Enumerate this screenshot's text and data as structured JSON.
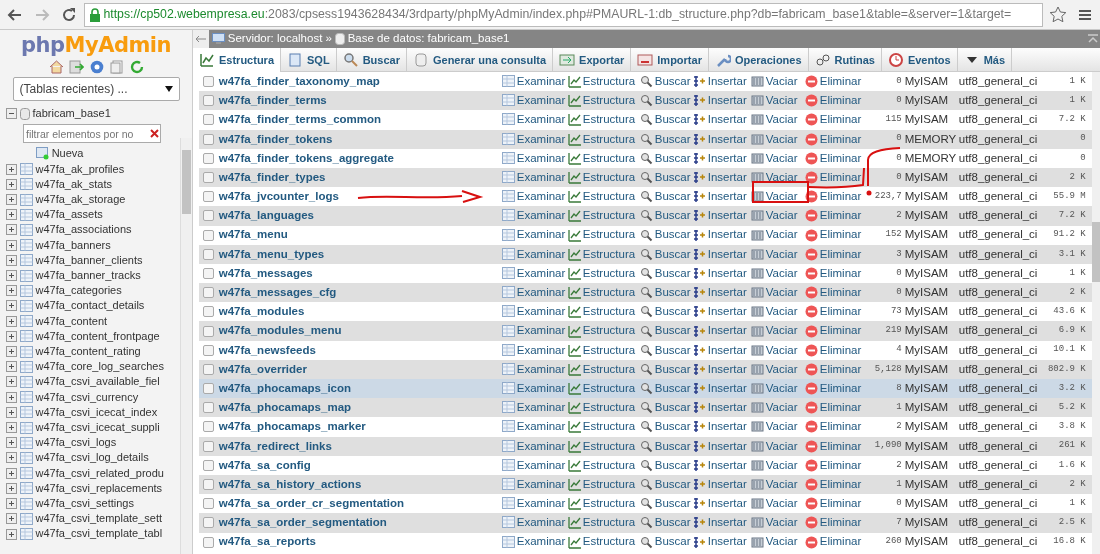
{
  "browser": {
    "url_host": "https://cp502.webempresa.eu",
    "url_rest": ":2083/cpsess1943628434/3rdparty/phpMyAdmin/index.php#PMAURL-1:db_structure.php?db=fabricam_base1&table=&server=1&target=",
    "forward_disabled": true
  },
  "sidebar": {
    "logo": [
      "php",
      "MyAdmin"
    ],
    "recent_select": "(Tablas recientes) ...",
    "tree": {
      "label": "fabricam_base1",
      "expanded": true,
      "filter_placeholder": "filtrar elementos por no",
      "new_label": "Nueva",
      "children": [
        {
          "label": "w47fa_ak_profiles",
          "expanded": false
        },
        {
          "label": "w47fa_ak_stats",
          "expanded": false
        },
        {
          "label": "w47fa_ak_storage",
          "expanded": false
        },
        {
          "label": "w47fa_assets",
          "expanded": false
        },
        {
          "label": "w47fa_associations",
          "expanded": false
        },
        {
          "label": "w47fa_banners",
          "expanded": false
        },
        {
          "label": "w47fa_banner_clients",
          "expanded": false
        },
        {
          "label": "w47fa_banner_tracks",
          "expanded": false
        },
        {
          "label": "w47fa_categories",
          "expanded": false
        },
        {
          "label": "w47fa_contact_details",
          "expanded": false
        },
        {
          "label": "w47fa_content",
          "expanded": false
        },
        {
          "label": "w47fa_content_frontpage",
          "expanded": false
        },
        {
          "label": "w47fa_content_rating",
          "expanded": false
        },
        {
          "label": "w47fa_core_log_searches",
          "expanded": false
        },
        {
          "label": "w47fa_csvi_available_fiel",
          "expanded": false
        },
        {
          "label": "w47fa_csvi_currency",
          "expanded": false
        },
        {
          "label": "w47fa_csvi_icecat_index",
          "expanded": false
        },
        {
          "label": "w47fa_csvi_icecat_suppli",
          "expanded": false
        },
        {
          "label": "w47fa_csvi_logs",
          "expanded": false
        },
        {
          "label": "w47fa_csvi_log_details",
          "expanded": false
        },
        {
          "label": "w47fa_csvi_related_produ",
          "expanded": false
        },
        {
          "label": "w47fa_csvi_replacements",
          "expanded": false
        },
        {
          "label": "w47fa_csvi_settings",
          "expanded": false
        },
        {
          "label": "w47fa_csvi_template_sett",
          "expanded": false
        },
        {
          "label": "w47fa_csvi_template_tabl",
          "expanded": false
        }
      ]
    }
  },
  "breadcrumb": {
    "server": "Servidor: localhost »",
    "database": "Base de datos: fabricam_base1"
  },
  "tabs": [
    {
      "label": "Estructura",
      "kind": "structure",
      "selected": true
    },
    {
      "label": "SQL",
      "kind": "sql",
      "selected": false
    },
    {
      "label": "Buscar",
      "kind": "search",
      "selected": false
    },
    {
      "label": "Generar una consulta",
      "kind": "query",
      "selected": false
    },
    {
      "label": "Exportar",
      "kind": "export",
      "selected": false
    },
    {
      "label": "Importar",
      "kind": "import",
      "selected": false
    },
    {
      "label": "Operaciones",
      "kind": "operations",
      "selected": false
    },
    {
      "label": "Rutinas",
      "kind": "routines",
      "selected": false
    },
    {
      "label": "Eventos",
      "kind": "events",
      "selected": false
    },
    {
      "label": "Más",
      "kind": "more",
      "selected": false
    }
  ],
  "table": {
    "rows": [
      {
        "name": "w47fa_finder_taxonomy_map",
        "checked": false,
        "selected": false,
        "actions": [
          "Examinar",
          "Estructura",
          "Buscar",
          "Insertar",
          "Vaciar",
          "Eliminar"
        ],
        "rows": "0",
        "engine": "MyISAM",
        "collation": "utf8_general_ci",
        "size": "1 K"
      },
      {
        "name": "w47fa_finder_terms",
        "checked": false,
        "selected": false,
        "actions": [
          "Examinar",
          "Estructura",
          "Buscar",
          "Insertar",
          "Vaciar",
          "Eliminar"
        ],
        "rows": "0",
        "engine": "MyISAM",
        "collation": "utf8_general_ci",
        "size": "1 K"
      },
      {
        "name": "w47fa_finder_terms_common",
        "checked": false,
        "selected": false,
        "actions": [
          "Examinar",
          "Estructura",
          "Buscar",
          "Insertar",
          "Vaciar",
          "Eliminar"
        ],
        "rows": "115",
        "engine": "MyISAM",
        "collation": "utf8_general_ci",
        "size": "7.2 K"
      },
      {
        "name": "w47fa_finder_tokens",
        "checked": false,
        "selected": false,
        "actions": [
          "Examinar",
          "Estructura",
          "Buscar",
          "Insertar",
          "Vaciar",
          "Eliminar"
        ],
        "rows": "0",
        "engine": "MEMORY",
        "collation": "utf8_general_ci",
        "size": "0"
      },
      {
        "name": "w47fa_finder_tokens_aggregate",
        "checked": false,
        "selected": false,
        "actions": [
          "Examinar",
          "Estructura",
          "Buscar",
          "Insertar",
          "Vaciar",
          "Eliminar"
        ],
        "rows": "0",
        "engine": "MEMORY",
        "collation": "utf8_general_ci",
        "size": "0"
      },
      {
        "name": "w47fa_finder_types",
        "checked": false,
        "selected": false,
        "actions": [
          "Examinar",
          "Estructura",
          "Buscar",
          "Insertar",
          "Vaciar",
          "Eliminar"
        ],
        "rows": "0",
        "engine": "MyISAM",
        "collation": "utf8_general_ci",
        "size": "2 K"
      },
      {
        "name": "w47fa_jvcounter_logs",
        "checked": false,
        "selected": false,
        "actions": [
          "Examinar",
          "Estructura",
          "Buscar",
          "Insertar",
          "Vaciar",
          "Eliminar"
        ],
        "rows": "223,7",
        "engine": "MyISAM",
        "collation": "utf8_general_ci",
        "size": "55.9 M"
      },
      {
        "name": "w47fa_languages",
        "checked": false,
        "selected": false,
        "actions": [
          "Examinar",
          "Estructura",
          "Buscar",
          "Insertar",
          "Vaciar",
          "Eliminar"
        ],
        "rows": "2",
        "engine": "MyISAM",
        "collation": "utf8_general_ci",
        "size": "7.2 K"
      },
      {
        "name": "w47fa_menu",
        "checked": false,
        "selected": false,
        "actions": [
          "Examinar",
          "Estructura",
          "Buscar",
          "Insertar",
          "Vaciar",
          "Eliminar"
        ],
        "rows": "152",
        "engine": "MyISAM",
        "collation": "utf8_general_ci",
        "size": "91.2 K"
      },
      {
        "name": "w47fa_menu_types",
        "checked": false,
        "selected": false,
        "actions": [
          "Examinar",
          "Estructura",
          "Buscar",
          "Insertar",
          "Vaciar",
          "Eliminar"
        ],
        "rows": "3",
        "engine": "MyISAM",
        "collation": "utf8_general_ci",
        "size": "3.1 K"
      },
      {
        "name": "w47fa_messages",
        "checked": false,
        "selected": false,
        "actions": [
          "Examinar",
          "Estructura",
          "Buscar",
          "Insertar",
          "Vaciar",
          "Eliminar"
        ],
        "rows": "0",
        "engine": "MyISAM",
        "collation": "utf8_general_ci",
        "size": "1 K"
      },
      {
        "name": "w47fa_messages_cfg",
        "checked": false,
        "selected": false,
        "actions": [
          "Examinar",
          "Estructura",
          "Buscar",
          "Insertar",
          "Vaciar",
          "Eliminar"
        ],
        "rows": "0",
        "engine": "MyISAM",
        "collation": "utf8_general_ci",
        "size": "2 K"
      },
      {
        "name": "w47fa_modules",
        "checked": false,
        "selected": false,
        "actions": [
          "Examinar",
          "Estructura",
          "Buscar",
          "Insertar",
          "Vaciar",
          "Eliminar"
        ],
        "rows": "73",
        "engine": "MyISAM",
        "collation": "utf8_general_ci",
        "size": "43.6 K"
      },
      {
        "name": "w47fa_modules_menu",
        "checked": false,
        "selected": false,
        "actions": [
          "Examinar",
          "Estructura",
          "Buscar",
          "Insertar",
          "Vaciar",
          "Eliminar"
        ],
        "rows": "219",
        "engine": "MyISAM",
        "collation": "utf8_general_ci",
        "size": "6.9 K"
      },
      {
        "name": "w47fa_newsfeeds",
        "checked": false,
        "selected": false,
        "actions": [
          "Examinar",
          "Estructura",
          "Buscar",
          "Insertar",
          "Vaciar",
          "Eliminar"
        ],
        "rows": "4",
        "engine": "MyISAM",
        "collation": "utf8_general_ci",
        "size": "10.1 K"
      },
      {
        "name": "w47fa_overrider",
        "checked": false,
        "selected": false,
        "actions": [
          "Examinar",
          "Estructura",
          "Buscar",
          "Insertar",
          "Vaciar",
          "Eliminar"
        ],
        "rows": "5,128",
        "engine": "MyISAM",
        "collation": "utf8_general_ci",
        "size": "802.9 K"
      },
      {
        "name": "w47fa_phocamaps_icon",
        "checked": false,
        "selected": true,
        "actions": [
          "Examinar",
          "Estructura",
          "Buscar",
          "Insertar",
          "Vaciar",
          "Eliminar"
        ],
        "rows": "8",
        "engine": "MyISAM",
        "collation": "utf8_general_ci",
        "size": "3.2 K"
      },
      {
        "name": "w47fa_phocamaps_map",
        "checked": false,
        "selected": false,
        "actions": [
          "Examinar",
          "Estructura",
          "Buscar",
          "Insertar",
          "Vaciar",
          "Eliminar"
        ],
        "rows": "1",
        "engine": "MyISAM",
        "collation": "utf8_general_ci",
        "size": "5.2 K"
      },
      {
        "name": "w47fa_phocamaps_marker",
        "checked": false,
        "selected": false,
        "actions": [
          "Examinar",
          "Estructura",
          "Buscar",
          "Insertar",
          "Vaciar",
          "Eliminar"
        ],
        "rows": "2",
        "engine": "MyISAM",
        "collation": "utf8_general_ci",
        "size": "3.8 K"
      },
      {
        "name": "w47fa_redirect_links",
        "checked": false,
        "selected": false,
        "actions": [
          "Examinar",
          "Estructura",
          "Buscar",
          "Insertar",
          "Vaciar",
          "Eliminar"
        ],
        "rows": "1,090",
        "engine": "MyISAM",
        "collation": "utf8_general_ci",
        "size": "261 K"
      },
      {
        "name": "w47fa_sa_config",
        "checked": false,
        "selected": false,
        "actions": [
          "Examinar",
          "Estructura",
          "Buscar",
          "Insertar",
          "Vaciar",
          "Eliminar"
        ],
        "rows": "2",
        "engine": "MyISAM",
        "collation": "utf8_general_ci",
        "size": "1.6 K"
      },
      {
        "name": "w47fa_sa_history_actions",
        "checked": false,
        "selected": false,
        "actions": [
          "Examinar",
          "Estructura",
          "Buscar",
          "Insertar",
          "Vaciar",
          "Eliminar"
        ],
        "rows": "1",
        "engine": "MyISAM",
        "collation": "utf8_general_ci",
        "size": "2 K"
      },
      {
        "name": "w47fa_sa_order_cr_segmentation",
        "checked": false,
        "selected": false,
        "actions": [
          "Examinar",
          "Estructura",
          "Buscar",
          "Insertar",
          "Vaciar",
          "Eliminar"
        ],
        "rows": "0",
        "engine": "MyISAM",
        "collation": "utf8_general_ci",
        "size": "1 K"
      },
      {
        "name": "w47fa_sa_order_segmentation",
        "checked": false,
        "selected": false,
        "actions": [
          "Examinar",
          "Estructura",
          "Buscar",
          "Insertar",
          "Vaciar",
          "Eliminar"
        ],
        "rows": "7",
        "engine": "MyISAM",
        "collation": "utf8_general_ci",
        "size": "2.5 K"
      },
      {
        "name": "w47fa_sa_reports",
        "checked": false,
        "selected": false,
        "actions": [
          "Examinar",
          "Estructura",
          "Buscar",
          "Insertar",
          "Vaciar",
          "Eliminar"
        ],
        "rows": "260",
        "engine": "MyISAM",
        "collation": "utf8_general_ci",
        "size": "16.8 K"
      }
    ]
  }
}
